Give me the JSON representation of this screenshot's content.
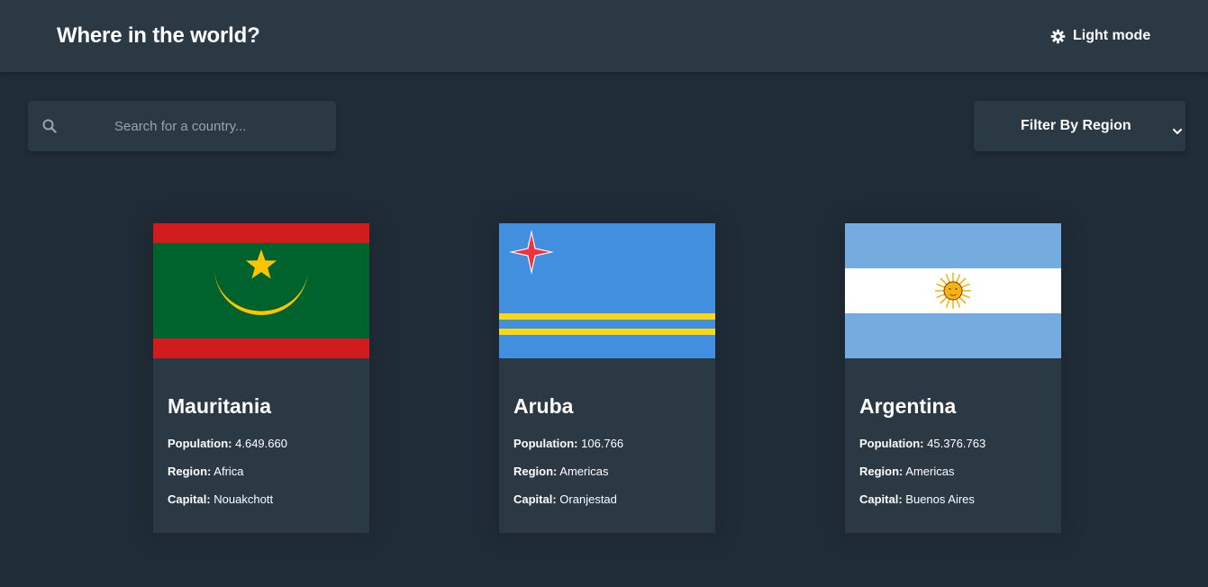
{
  "header": {
    "title": "Where in the world?",
    "mode_toggle_label": "Light mode",
    "mode_icon": "sun-gear-icon"
  },
  "search": {
    "placeholder": "Search for a country...",
    "value": "",
    "icon": "search-icon"
  },
  "filter": {
    "label": "Filter By Region",
    "icon": "chevron-down-icon"
  },
  "labels": {
    "population": "Population:",
    "region": "Region:",
    "capital": "Capital:"
  },
  "countries": [
    {
      "name": "Mauritania",
      "population": "4.649.660",
      "region": "Africa",
      "capital": "Nouakchott",
      "flag": "mauritania-flag"
    },
    {
      "name": "Aruba",
      "population": "106.766",
      "region": "Americas",
      "capital": "Oranjestad",
      "flag": "aruba-flag"
    },
    {
      "name": "Argentina",
      "population": "45.376.763",
      "region": "Americas",
      "capital": "Buenos Aires",
      "flag": "argentina-flag"
    }
  ],
  "colors": {
    "background": "#202c37",
    "surface": "#2b3945",
    "text": "#ffffff",
    "placeholder": "#9aa3ab"
  }
}
